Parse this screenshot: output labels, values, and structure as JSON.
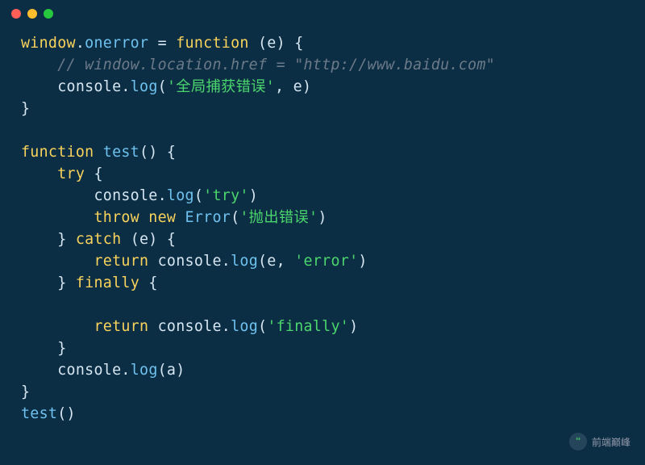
{
  "titlebar": {
    "red": "#ff5f56",
    "yellow": "#ffbd2e",
    "green": "#27c93f"
  },
  "code": {
    "l1": {
      "t1": "window",
      "t2": ".",
      "t3": "onerror",
      "t4": " = ",
      "t5": "function",
      "t6": " (e) {"
    },
    "l2": {
      "indent": "    ",
      "cmt": "// window.location.href = \"http://www.baidu.com\""
    },
    "l3": {
      "indent": "    ",
      "t1": "console",
      "t2": ".",
      "t3": "log",
      "t4": "(",
      "t5": "'全局捕获错误'",
      "t6": ", e)"
    },
    "l4": {
      "t1": "}"
    },
    "l5": {
      "t1": ""
    },
    "l6": {
      "t1": "function",
      "t2": " ",
      "t3": "test",
      "t4": "() {"
    },
    "l7": {
      "indent": "    ",
      "t1": "try",
      "t2": " {"
    },
    "l8": {
      "indent": "        ",
      "t1": "console",
      "t2": ".",
      "t3": "log",
      "t4": "(",
      "t5": "'try'",
      "t6": ")"
    },
    "l9": {
      "indent": "        ",
      "t1": "throw",
      "t2": " ",
      "t3": "new",
      "t4": " ",
      "t5": "Error",
      "t6": "(",
      "t7": "'抛出错误'",
      "t8": ")"
    },
    "l10": {
      "indent": "    ",
      "t1": "} ",
      "t2": "catch",
      "t3": " (e) {"
    },
    "l11": {
      "indent": "        ",
      "t1": "return",
      "t2": " ",
      "t3": "console",
      "t4": ".",
      "t5": "log",
      "t6": "(e, ",
      "t7": "'error'",
      "t8": ")"
    },
    "l12": {
      "indent": "    ",
      "t1": "} ",
      "t2": "finally",
      "t3": " {"
    },
    "l13": {
      "t1": ""
    },
    "l14": {
      "indent": "        ",
      "t1": "return",
      "t2": " ",
      "t3": "console",
      "t4": ".",
      "t5": "log",
      "t6": "(",
      "t7": "'finally'",
      "t8": ")"
    },
    "l15": {
      "indent": "    ",
      "t1": "}"
    },
    "l16": {
      "indent": "    ",
      "t1": "console",
      "t2": ".",
      "t3": "log",
      "t4": "(a)"
    },
    "l17": {
      "t1": "}"
    },
    "l18": {
      "t1": "test",
      "t2": "()"
    }
  },
  "watermark": {
    "icon": "❝",
    "text": "前端巅峰"
  }
}
